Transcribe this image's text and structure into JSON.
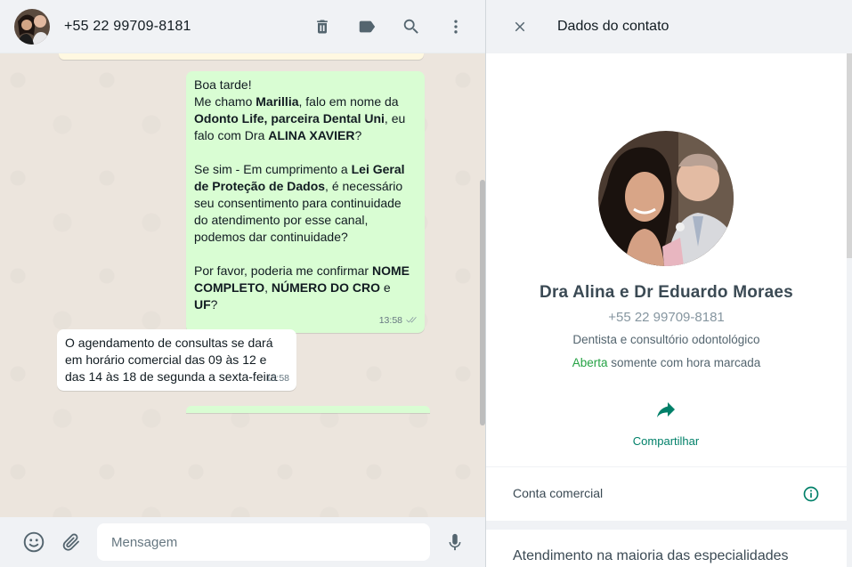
{
  "chat": {
    "contact_title": "+55 22 99709-8181",
    "icons": [
      "avatar",
      "delete-icon",
      "label-icon",
      "search-icon",
      "menu-icon"
    ],
    "messages": {
      "outgoing_1": {
        "line1": "Boa tarde!",
        "line2_a": "Me chamo ",
        "line2_b": "Marillia",
        "line2_c": ", falo em nome da ",
        "line3_b": "Odonto Life, parceira Dental Uni",
        "line3_c": ", eu falo com Dra ",
        "line4_b": "ALINA XAVIER",
        "line4_c": "?",
        "para2_a": "Se sim - Em cumprimento a ",
        "para2_b": "Lei Geral de Proteção de Dados",
        "para2_c": ", é necessário seu consentimento para continuidade do atendimento por esse canal, podemos dar continuidade?",
        "para3_a": "Por favor, poderia me confirmar ",
        "para3_b": "NOME COMPLETO",
        "para3_c": ", ",
        "para3_d": "NÚMERO DO CRO",
        "para3_e": " e ",
        "para3_f": "UF",
        "para3_g": "?",
        "time": "13:58"
      },
      "incoming_1": {
        "text": "O agendamento de consultas se dará em horário comercial das 09 às 12 e das 14 às 18 de segunda a sexta-feira",
        "time": "13:58"
      }
    },
    "footer": {
      "placeholder": "Mensagem"
    }
  },
  "contact_info": {
    "header_title": "Dados do contato",
    "name": "Dra Alina e Dr Eduardo Moraes",
    "phone": "+55 22 99709-8181",
    "description": "Dentista e consultório odontológico",
    "hours_status": "Aberta",
    "hours_detail": " somente com hora marcada",
    "share_label": "Compartilhar",
    "business_label": "Conta comercial",
    "about": "Atendimento na maioria das especialidades"
  },
  "colors": {
    "accent_green": "#008069",
    "open_green": "#25a244",
    "outgoing_bubble": "#d9fdd3",
    "icon_gray": "#54656f"
  }
}
